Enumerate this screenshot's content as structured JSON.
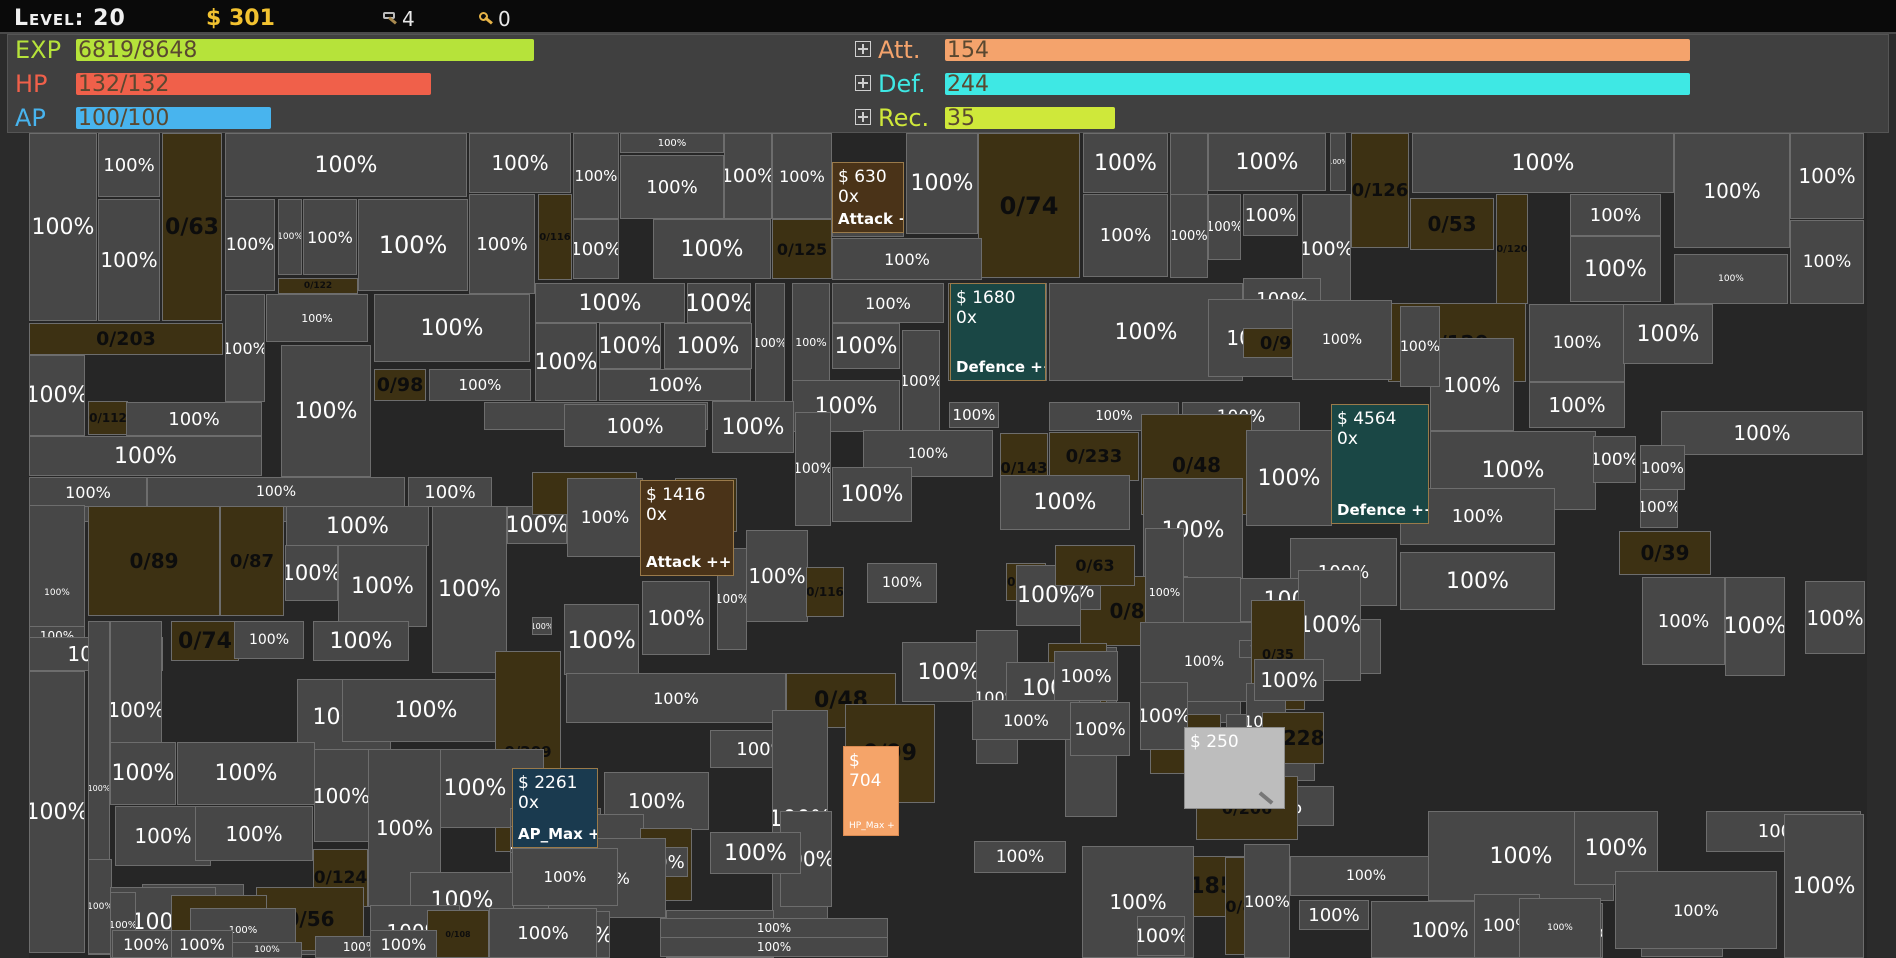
{
  "header": {
    "level_label": "Level: 20",
    "money": "$ 301",
    "pickaxes": "4",
    "keys": "0"
  },
  "stats": {
    "exp": {
      "label": "EXP",
      "value": "6819/8648",
      "fill": 0.79,
      "color": "#b6e33a"
    },
    "hp": {
      "label": "HP",
      "value": "132/132",
      "fill": 1.0,
      "color": "#f0604a"
    },
    "ap": {
      "label": "AP",
      "value": "100/100",
      "fill": 1.0,
      "color": "#48b4ee"
    },
    "att": {
      "label": "Att.",
      "value": "154"
    },
    "def": {
      "label": "Def.",
      "value": "244"
    },
    "rec": {
      "label": "Rec.",
      "value": "35"
    }
  },
  "shops": [
    {
      "id": "attack-plus",
      "price": "$ 630",
      "owned": "0x",
      "name": "Attack +",
      "color": "#4a3318"
    },
    {
      "id": "defence-plus-plus",
      "price": "$ 1680",
      "owned": "0x",
      "name": "Defence ++",
      "color": "#1a4745"
    },
    {
      "id": "attack-plus-plus",
      "price": "$ 1416",
      "owned": "0x",
      "name": "Attack ++",
      "color": "#4a3318"
    },
    {
      "id": "defence-plus-4",
      "price": "$ 4564",
      "owned": "0x",
      "name": "Defence ++++",
      "color": "#1a4745"
    },
    {
      "id": "ap-max-plus",
      "price": "$ 2261",
      "owned": "0x",
      "name": "AP_Max +",
      "color": "#1a3a4f"
    },
    {
      "id": "hp-max-plus",
      "price": "$ 704",
      "owned": "",
      "name": "HP_Max +",
      "color": "#f5a469"
    },
    {
      "id": "pickaxe-shop",
      "price": "$ 250",
      "owned": "",
      "name": "",
      "color": "#bdbdbd"
    }
  ],
  "cells": [
    {
      "t": "100%"
    },
    {
      "t": "100%"
    },
    {
      "t": "0/63",
      "l": 1
    },
    {
      "t": "100%"
    },
    {
      "t": "100%"
    },
    {
      "t": "100%"
    },
    {
      "t": "100%"
    },
    {
      "t": "100%"
    },
    {
      "t": "100%"
    },
    {
      "t": "100%"
    },
    {
      "t": "100%"
    },
    {
      "t": "0/74",
      "l": 1
    },
    {
      "t": "100%"
    },
    {
      "t": "100%"
    },
    {
      "t": "100%"
    },
    {
      "t": "100%"
    },
    {
      "t": "0/126",
      "l": 1
    },
    {
      "t": "100%"
    },
    {
      "t": "100%"
    },
    {
      "t": "100%"
    },
    {
      "t": "100%"
    },
    {
      "t": "100%"
    },
    {
      "t": "100%"
    },
    {
      "t": "100%"
    },
    {
      "t": "100%"
    },
    {
      "t": "100%"
    },
    {
      "t": "0/116",
      "l": 1
    },
    {
      "t": "100%"
    },
    {
      "t": "100%"
    },
    {
      "t": "100%"
    },
    {
      "t": "0/125",
      "l": 1
    },
    {
      "t": "100%"
    },
    {
      "t": "100%"
    },
    {
      "t": "100%"
    },
    {
      "t": "100%"
    },
    {
      "t": "100%"
    },
    {
      "t": "100%"
    },
    {
      "t": "0/53",
      "l": 1
    },
    {
      "t": "0/120",
      "l": 1
    },
    {
      "t": "100%"
    },
    {
      "t": "100%"
    },
    {
      "t": "100%"
    },
    {
      "t": "100%"
    },
    {
      "t": "0/122",
      "l": 1
    },
    {
      "t": "100%"
    },
    {
      "t": "100%"
    },
    {
      "t": "100%"
    },
    {
      "t": "100%"
    },
    {
      "t": "0/157",
      "l": 1
    },
    {
      "t": "100%"
    },
    {
      "t": "0/120",
      "l": 1
    },
    {
      "t": "0/203",
      "l": 1
    },
    {
      "t": "100%"
    },
    {
      "t": "100%"
    },
    {
      "t": "100%"
    },
    {
      "t": "100%"
    },
    {
      "t": "100%"
    },
    {
      "t": "100%"
    },
    {
      "t": "100%"
    },
    {
      "t": "100%"
    },
    {
      "t": "100%"
    },
    {
      "t": "100%"
    },
    {
      "t": "100%"
    },
    {
      "t": "100%"
    },
    {
      "t": "100%"
    },
    {
      "t": "100%"
    },
    {
      "t": "100%"
    },
    {
      "t": "100%"
    },
    {
      "t": "0/98",
      "l": 1
    },
    {
      "t": "100%"
    },
    {
      "t": "100%"
    },
    {
      "t": "100%"
    },
    {
      "t": "100%"
    },
    {
      "t": "0/95",
      "l": 1
    },
    {
      "t": "100%"
    },
    {
      "t": "100%"
    },
    {
      "t": "100%"
    },
    {
      "t": "0/112",
      "l": 1
    },
    {
      "t": "100%"
    },
    {
      "t": "100%"
    },
    {
      "t": "100%"
    },
    {
      "t": "100%"
    },
    {
      "t": "100%"
    },
    {
      "t": "0/143",
      "l": 1
    },
    {
      "t": "0/233",
      "l": 1
    },
    {
      "t": "0/48",
      "l": 1
    },
    {
      "t": "100%"
    },
    {
      "t": "100%"
    },
    {
      "t": "100%"
    },
    {
      "t": "100%"
    },
    {
      "t": "100%"
    },
    {
      "t": "100%"
    },
    {
      "t": "100%"
    },
    {
      "t": "100%"
    },
    {
      "t": "100%"
    },
    {
      "t": "100%"
    },
    {
      "t": "100%"
    },
    {
      "t": "100%"
    },
    {
      "t": "100%"
    },
    {
      "t": "100%"
    },
    {
      "t": "0/89",
      "l": 1
    },
    {
      "t": "100%"
    },
    {
      "t": "100%"
    },
    {
      "t": "100%"
    },
    {
      "t": "0/54",
      "l": 1
    },
    {
      "t": "100%"
    },
    {
      "t": "100%"
    },
    {
      "t": "100%"
    },
    {
      "t": "100%"
    },
    {
      "t": "100%"
    },
    {
      "t": "100%"
    },
    {
      "t": "100%"
    },
    {
      "t": "0/87",
      "l": 1
    },
    {
      "t": "100%"
    },
    {
      "t": "100%"
    },
    {
      "t": "100%"
    },
    {
      "t": "0/137",
      "l": 1
    },
    {
      "t": "100%"
    },
    {
      "t": "0/148",
      "l": 1
    },
    {
      "t": "0/82",
      "l": 1
    },
    {
      "t": "100%"
    },
    {
      "t": "100%"
    },
    {
      "t": "100%"
    },
    {
      "t": "0/39",
      "l": 1
    },
    {
      "t": "100%"
    },
    {
      "t": "100%"
    },
    {
      "t": "100%"
    },
    {
      "t": "100%"
    },
    {
      "t": "100%"
    },
    {
      "t": "100%"
    },
    {
      "t": "100%"
    },
    {
      "t": "100%"
    },
    {
      "t": "100%"
    },
    {
      "t": "100%"
    },
    {
      "t": "100%"
    },
    {
      "t": "100%"
    },
    {
      "t": "100%"
    },
    {
      "t": "100%"
    },
    {
      "t": "0/116",
      "l": 1
    },
    {
      "t": "100%"
    },
    {
      "t": "0/63",
      "l": 1
    },
    {
      "t": "100%"
    },
    {
      "t": "100%"
    },
    {
      "t": "100%"
    },
    {
      "t": "100%"
    },
    {
      "t": "0/35",
      "l": 1
    },
    {
      "t": "100%"
    },
    {
      "t": "100%"
    },
    {
      "t": "0/74",
      "l": 1
    },
    {
      "t": "100%"
    },
    {
      "t": "100%"
    },
    {
      "t": "100%"
    },
    {
      "t": "0/48",
      "l": 1
    },
    {
      "t": "100%"
    },
    {
      "t": "100%"
    },
    {
      "t": "0/117",
      "l": 1
    },
    {
      "t": "100%"
    },
    {
      "t": "100%"
    },
    {
      "t": "100%"
    },
    {
      "t": "100%"
    },
    {
      "t": "0/209",
      "l": 1
    },
    {
      "t": "0/28",
      "l": 1
    },
    {
      "t": "100%"
    },
    {
      "t": "100%"
    },
    {
      "t": "100%"
    },
    {
      "t": "100%"
    },
    {
      "t": "0/228",
      "l": 1
    },
    {
      "t": "100%"
    },
    {
      "t": "100%"
    },
    {
      "t": "100%"
    },
    {
      "t": "100%"
    },
    {
      "t": "100%"
    },
    {
      "t": "100%"
    },
    {
      "t": "100%"
    },
    {
      "t": "100%"
    },
    {
      "t": "100%"
    },
    {
      "t": "100%"
    },
    {
      "t": "100%"
    },
    {
      "t": "0/103",
      "l": 1
    },
    {
      "t": "100%"
    },
    {
      "t": "100%"
    },
    {
      "t": "100%"
    },
    {
      "t": "100%"
    },
    {
      "t": "100%"
    },
    {
      "t": "100%"
    },
    {
      "t": "0/72",
      "l": 1
    },
    {
      "t": "100%"
    },
    {
      "t": "0/99",
      "l": 1
    },
    {
      "t": "100%"
    },
    {
      "t": "100%"
    },
    {
      "t": "100%"
    },
    {
      "t": "0/124",
      "l": 1
    },
    {
      "t": "100%"
    },
    {
      "t": "100%"
    },
    {
      "t": "100%"
    },
    {
      "t": "100%"
    },
    {
      "t": "100%"
    },
    {
      "t": "0/185",
      "l": 1
    },
    {
      "t": "100%"
    },
    {
      "t": "100%"
    },
    {
      "t": "0/56",
      "l": 1
    },
    {
      "t": "100%"
    },
    {
      "t": "100%"
    },
    {
      "t": "0/206",
      "l": 1
    },
    {
      "t": "100%"
    },
    {
      "t": "100%"
    },
    {
      "t": "100%"
    },
    {
      "t": "100%"
    },
    {
      "t": "0/95",
      "l": 1
    },
    {
      "t": "100%"
    },
    {
      "t": "100%"
    },
    {
      "t": "100%"
    },
    {
      "t": "100%"
    },
    {
      "t": "0/81",
      "l": 1
    },
    {
      "t": "100%"
    },
    {
      "t": "100%"
    },
    {
      "t": "100%"
    },
    {
      "t": "100%"
    },
    {
      "t": "100%"
    },
    {
      "t": "100%"
    },
    {
      "t": "0/108",
      "l": 1
    },
    {
      "t": "100%"
    },
    {
      "t": "100%"
    },
    {
      "t": "100%"
    },
    {
      "t": "100%"
    },
    {
      "t": "100%"
    },
    {
      "t": "100%"
    },
    {
      "t": "100%"
    },
    {
      "t": "100%"
    },
    {
      "t": "100%"
    },
    {
      "t": "100%"
    },
    {
      "t": "100%"
    },
    {
      "t": "100%"
    },
    {
      "t": "100%"
    },
    {
      "t": "100%"
    },
    {
      "t": "100%"
    }
  ]
}
